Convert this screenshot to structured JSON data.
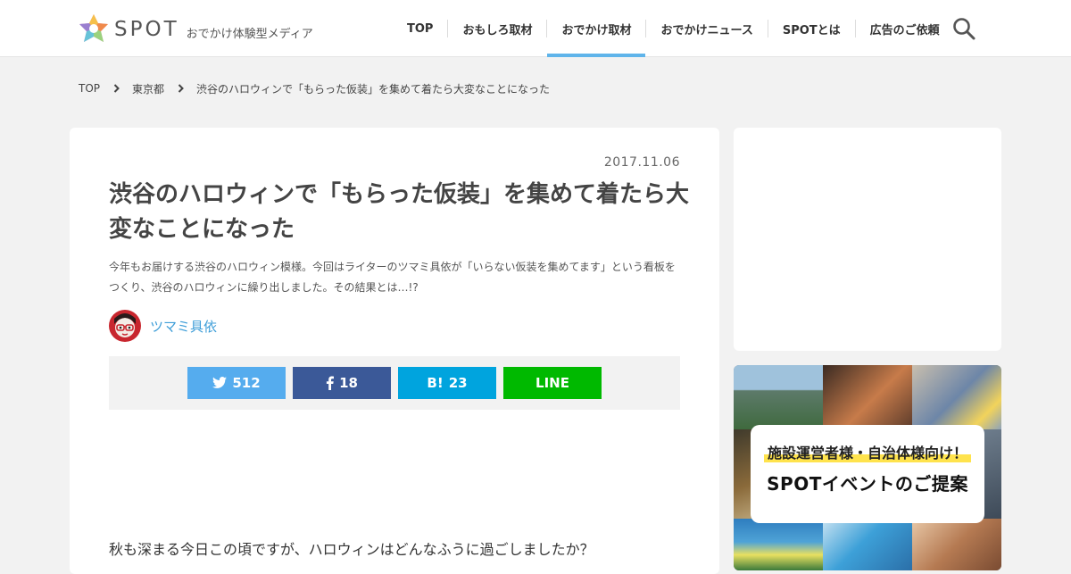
{
  "header": {
    "logo_text": "SPOT",
    "tagline": "おでかけ体験型メディア",
    "nav": [
      {
        "label": "TOP",
        "active": false
      },
      {
        "label": "おもしろ取材",
        "active": false
      },
      {
        "label": "おでかけ取材",
        "active": true
      },
      {
        "label": "おでかけニュース",
        "active": false
      },
      {
        "label": "SPOTとは",
        "active": false
      },
      {
        "label": "広告のご依頼",
        "active": false
      }
    ],
    "search_icon": "search-icon",
    "accent_color": "#5fb4ea"
  },
  "breadcrumb": [
    "TOP",
    "東京都",
    "渋谷のハロウィンで「もらった仮装」を集めて着たら大変なことになった"
  ],
  "article": {
    "date": "2017.11.06",
    "title": "渋谷のハロウィンで「もらった仮装」を集めて着たら大変なことになった",
    "lead": "今年もお届けする渋谷のハロウィン模様。今回はライターのツマミ具依が「いらない仮装を集めてます」という看板をつくり、渋谷のハロウィンに繰り出しました。その結果とは…!?",
    "author": "ツマミ具依",
    "share": {
      "twitter": {
        "icon": "twitter-icon",
        "count": "512",
        "color": "#55acee"
      },
      "facebook": {
        "icon": "facebook-icon",
        "count": "18",
        "color": "#3b5998"
      },
      "hatena": {
        "label": "B!",
        "count": "23",
        "color": "#00a4de"
      },
      "line": {
        "label": "LINE",
        "color": "#00b900"
      }
    },
    "body_first_line": "秋も深まる今日この頃ですが、ハロウィンはどんなふうに過ごしましたか？"
  },
  "sidebar": {
    "banner": {
      "line1": "施設運営者様・自治体様向け！",
      "line2": "SPOTイベントのご提案"
    }
  }
}
